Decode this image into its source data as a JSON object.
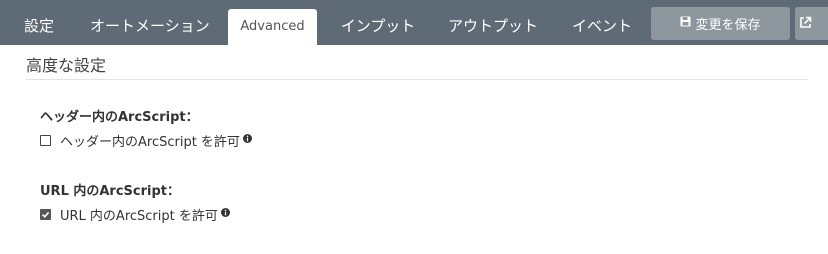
{
  "tabs": [
    {
      "label": "設定",
      "active": false
    },
    {
      "label": "オートメーション",
      "active": false
    },
    {
      "label": "Advanced",
      "active": true
    },
    {
      "label": "インプット",
      "active": false
    },
    {
      "label": "アウトプット",
      "active": false
    },
    {
      "label": "イベント",
      "active": false
    }
  ],
  "toolbar": {
    "save_label": "変更を保存",
    "save_icon": "floppy-disk-icon",
    "external_icon": "external-link-icon"
  },
  "section": {
    "title": "高度な設定"
  },
  "groups": [
    {
      "label": "ヘッダー内のArcScript：",
      "checkbox_label": "ヘッダー内のArcScript を許可",
      "checked": false,
      "info_icon": "info-icon"
    },
    {
      "label": "URL 内のArcScript：",
      "checkbox_label": "URL 内のArcScript を許可",
      "checked": true,
      "info_icon": "info-icon"
    }
  ],
  "colors": {
    "tabbar": "#5e6b76",
    "button": "#8f979e",
    "active_tab_bg": "#ffffff"
  }
}
